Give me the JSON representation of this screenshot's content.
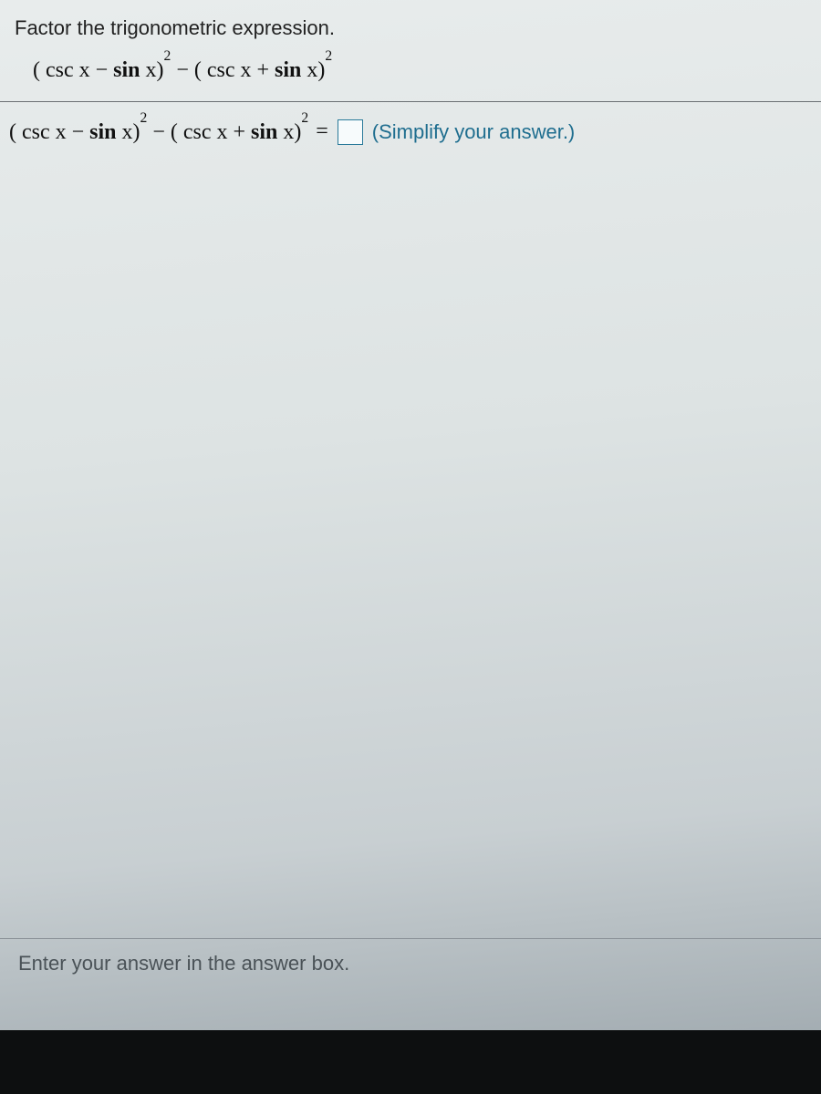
{
  "question": {
    "prompt": "Factor the trigonometric expression.",
    "expression_html": "( csc x − <b>sin</b> x)<sup>2</sup> − ( csc x + <b>sin</b> x)<sup>2</sup>",
    "answer_lhs_html": "( csc x − <b>sin</b> x)<sup>2</sup> − ( csc x + <b>sin</b> x)<sup>2</sup>",
    "equals": "=",
    "hint": "(Simplify your answer.)"
  },
  "footer": {
    "instruction": "Enter your answer in the answer box."
  }
}
